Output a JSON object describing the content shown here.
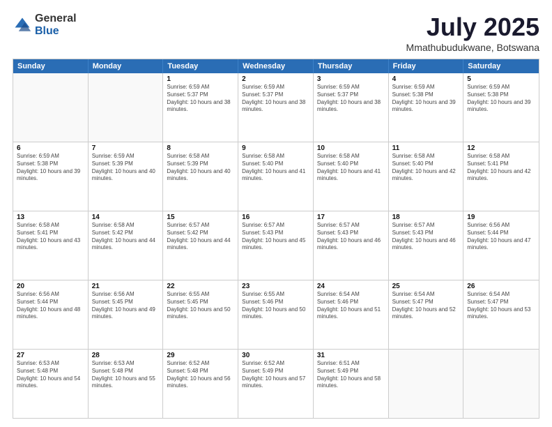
{
  "logo": {
    "general": "General",
    "blue": "Blue"
  },
  "header": {
    "title": "July 2025",
    "subtitle": "Mmathubudukwane, Botswana"
  },
  "calendar": {
    "days": [
      "Sunday",
      "Monday",
      "Tuesday",
      "Wednesday",
      "Thursday",
      "Friday",
      "Saturday"
    ],
    "weeks": [
      [
        {
          "day": "",
          "content": ""
        },
        {
          "day": "",
          "content": ""
        },
        {
          "day": "1",
          "content": "Sunrise: 6:59 AM\nSunset: 5:37 PM\nDaylight: 10 hours and 38 minutes."
        },
        {
          "day": "2",
          "content": "Sunrise: 6:59 AM\nSunset: 5:37 PM\nDaylight: 10 hours and 38 minutes."
        },
        {
          "day": "3",
          "content": "Sunrise: 6:59 AM\nSunset: 5:37 PM\nDaylight: 10 hours and 38 minutes."
        },
        {
          "day": "4",
          "content": "Sunrise: 6:59 AM\nSunset: 5:38 PM\nDaylight: 10 hours and 39 minutes."
        },
        {
          "day": "5",
          "content": "Sunrise: 6:59 AM\nSunset: 5:38 PM\nDaylight: 10 hours and 39 minutes."
        }
      ],
      [
        {
          "day": "6",
          "content": "Sunrise: 6:59 AM\nSunset: 5:38 PM\nDaylight: 10 hours and 39 minutes."
        },
        {
          "day": "7",
          "content": "Sunrise: 6:59 AM\nSunset: 5:39 PM\nDaylight: 10 hours and 40 minutes."
        },
        {
          "day": "8",
          "content": "Sunrise: 6:58 AM\nSunset: 5:39 PM\nDaylight: 10 hours and 40 minutes."
        },
        {
          "day": "9",
          "content": "Sunrise: 6:58 AM\nSunset: 5:40 PM\nDaylight: 10 hours and 41 minutes."
        },
        {
          "day": "10",
          "content": "Sunrise: 6:58 AM\nSunset: 5:40 PM\nDaylight: 10 hours and 41 minutes."
        },
        {
          "day": "11",
          "content": "Sunrise: 6:58 AM\nSunset: 5:40 PM\nDaylight: 10 hours and 42 minutes."
        },
        {
          "day": "12",
          "content": "Sunrise: 6:58 AM\nSunset: 5:41 PM\nDaylight: 10 hours and 42 minutes."
        }
      ],
      [
        {
          "day": "13",
          "content": "Sunrise: 6:58 AM\nSunset: 5:41 PM\nDaylight: 10 hours and 43 minutes."
        },
        {
          "day": "14",
          "content": "Sunrise: 6:58 AM\nSunset: 5:42 PM\nDaylight: 10 hours and 44 minutes."
        },
        {
          "day": "15",
          "content": "Sunrise: 6:57 AM\nSunset: 5:42 PM\nDaylight: 10 hours and 44 minutes."
        },
        {
          "day": "16",
          "content": "Sunrise: 6:57 AM\nSunset: 5:43 PM\nDaylight: 10 hours and 45 minutes."
        },
        {
          "day": "17",
          "content": "Sunrise: 6:57 AM\nSunset: 5:43 PM\nDaylight: 10 hours and 46 minutes."
        },
        {
          "day": "18",
          "content": "Sunrise: 6:57 AM\nSunset: 5:43 PM\nDaylight: 10 hours and 46 minutes."
        },
        {
          "day": "19",
          "content": "Sunrise: 6:56 AM\nSunset: 5:44 PM\nDaylight: 10 hours and 47 minutes."
        }
      ],
      [
        {
          "day": "20",
          "content": "Sunrise: 6:56 AM\nSunset: 5:44 PM\nDaylight: 10 hours and 48 minutes."
        },
        {
          "day": "21",
          "content": "Sunrise: 6:56 AM\nSunset: 5:45 PM\nDaylight: 10 hours and 49 minutes."
        },
        {
          "day": "22",
          "content": "Sunrise: 6:55 AM\nSunset: 5:45 PM\nDaylight: 10 hours and 50 minutes."
        },
        {
          "day": "23",
          "content": "Sunrise: 6:55 AM\nSunset: 5:46 PM\nDaylight: 10 hours and 50 minutes."
        },
        {
          "day": "24",
          "content": "Sunrise: 6:54 AM\nSunset: 5:46 PM\nDaylight: 10 hours and 51 minutes."
        },
        {
          "day": "25",
          "content": "Sunrise: 6:54 AM\nSunset: 5:47 PM\nDaylight: 10 hours and 52 minutes."
        },
        {
          "day": "26",
          "content": "Sunrise: 6:54 AM\nSunset: 5:47 PM\nDaylight: 10 hours and 53 minutes."
        }
      ],
      [
        {
          "day": "27",
          "content": "Sunrise: 6:53 AM\nSunset: 5:48 PM\nDaylight: 10 hours and 54 minutes."
        },
        {
          "day": "28",
          "content": "Sunrise: 6:53 AM\nSunset: 5:48 PM\nDaylight: 10 hours and 55 minutes."
        },
        {
          "day": "29",
          "content": "Sunrise: 6:52 AM\nSunset: 5:48 PM\nDaylight: 10 hours and 56 minutes."
        },
        {
          "day": "30",
          "content": "Sunrise: 6:52 AM\nSunset: 5:49 PM\nDaylight: 10 hours and 57 minutes."
        },
        {
          "day": "31",
          "content": "Sunrise: 6:51 AM\nSunset: 5:49 PM\nDaylight: 10 hours and 58 minutes."
        },
        {
          "day": "",
          "content": ""
        },
        {
          "day": "",
          "content": ""
        }
      ]
    ]
  }
}
